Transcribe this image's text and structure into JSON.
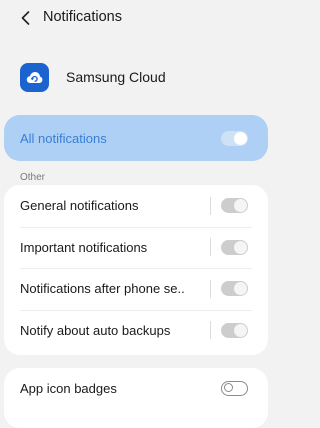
{
  "header": {
    "title": "Notifications",
    "back_icon": "chevron-left-icon"
  },
  "app": {
    "name": "Samsung Cloud",
    "icon": "samsung-cloud-icon",
    "icon_color": "#1b64d0"
  },
  "all_notifications": {
    "label": "All notifications",
    "enabled": true
  },
  "section": {
    "other_label": "Other"
  },
  "categories": [
    {
      "label": "General notifications",
      "enabled": true
    },
    {
      "label": "Important notifications",
      "enabled": true
    },
    {
      "label": "Notifications after phone se..",
      "enabled": true
    },
    {
      "label": "Notify about auto backups",
      "enabled": true
    }
  ],
  "app_icon_badges": {
    "label": "App icon badges",
    "enabled": false
  },
  "colors": {
    "accent": "#3a7ed6",
    "highlight_card": "#aed0f4",
    "background": "#f2f2f2"
  }
}
